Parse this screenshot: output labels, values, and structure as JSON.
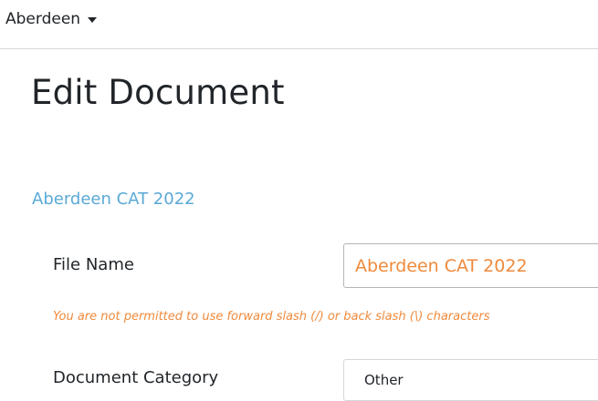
{
  "topbar": {
    "location_label": "Aberdeen",
    "location_icon": "caret-down-icon"
  },
  "page": {
    "title": "Edit Document",
    "document_link": "Aberdeen CAT 2022"
  },
  "form": {
    "file_name": {
      "label": "File Name",
      "value": "Aberdeen CAT 2022",
      "hint": "You are not permitted to use forward slash (/) or back slash (\\) characters"
    },
    "document_category": {
      "label": "Document Category",
      "selected": "Other"
    }
  },
  "colors": {
    "link": "#5aa9d6",
    "warning": "#f08a3c",
    "text": "#212529",
    "border": "#d7d7d7"
  }
}
